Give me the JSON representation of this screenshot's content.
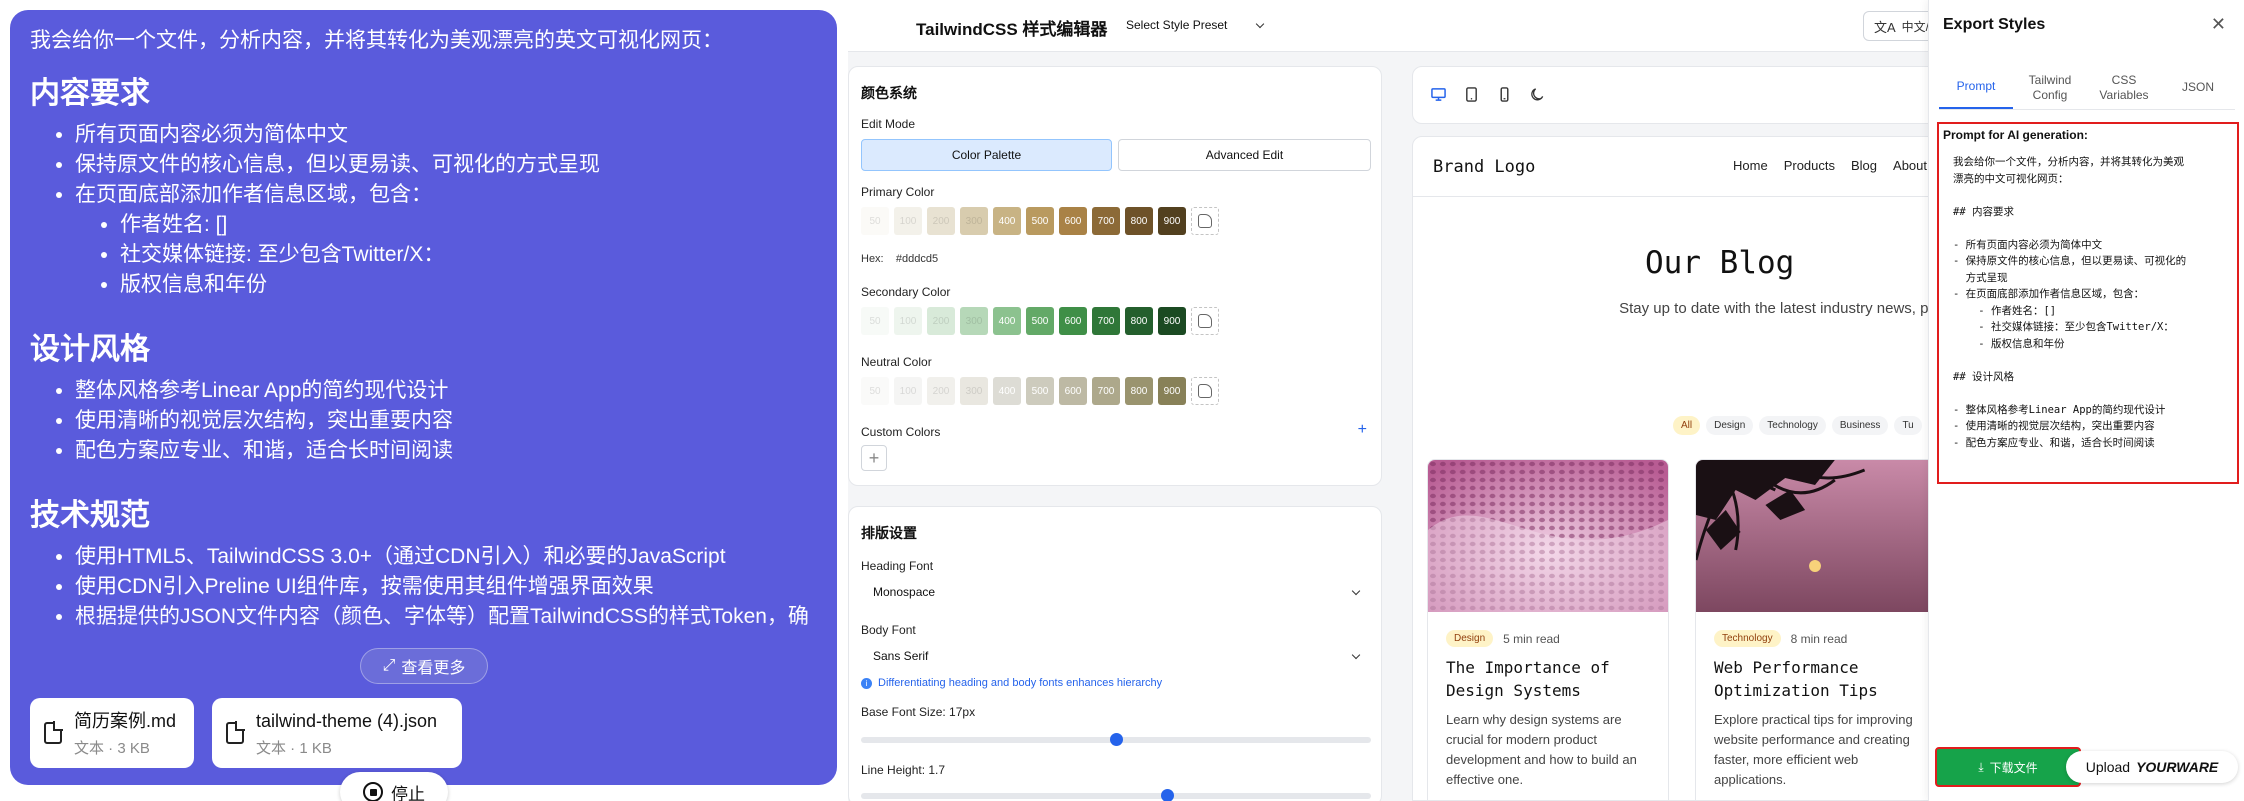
{
  "chat": {
    "intro": "我会给你一个文件，分析内容，并将其转化为美观漂亮的英文可视化网页：",
    "sections": [
      {
        "heading": "内容要求",
        "items": [
          "所有页面内容必须为简体中文",
          "保持原文件的核心信息，但以更易读、可视化的方式呈现",
          "在页面底部添加作者信息区域，包含："
        ],
        "subitems": [
          "作者姓名: []",
          "社交媒体链接: 至少包含Twitter/X：",
          "版权信息和年份"
        ]
      },
      {
        "heading": "设计风格",
        "items": [
          "整体风格参考Linear App的简约现代设计",
          "使用清晰的视觉层次结构，突出重要内容",
          "配色方案应专业、和谐，适合长时间阅读"
        ]
      },
      {
        "heading": "技术规范",
        "items": [
          "使用HTML5、TailwindCSS 3.0+（通过CDN引入）和必要的JavaScript",
          "使用CDN引入Preline UI组件库，按需使用其组件增强界面效果",
          "根据提供的JSON文件内容（颜色、字体等）配置TailwindCSS的样式Token，确"
        ]
      }
    ],
    "see_more": "查看更多",
    "files": [
      {
        "name": "简历案例.md",
        "meta": "文本 · 3 KB"
      },
      {
        "name": "tailwind-theme (4).json",
        "meta": "文本 · 1 KB"
      }
    ],
    "stop": "停止",
    "colors": {
      "bubble": "#5a5bdc"
    }
  },
  "editor": {
    "title": "TailwindCSS 样式编辑器",
    "preset": "Select Style Preset",
    "lang": "中文/E",
    "color_system": {
      "title": "颜色系统",
      "edit_mode_label": "Edit Mode",
      "modes": [
        "Color Palette",
        "Advanced Edit"
      ],
      "primary_label": "Primary Color",
      "hex_label": "Hex:",
      "hex_value": "#dddcd5",
      "secondary_label": "Secondary Color",
      "neutral_label": "Neutral Color",
      "custom_label": "Custom Colors",
      "shade_labels": [
        "50",
        "100",
        "200",
        "300",
        "400",
        "500",
        "600",
        "700",
        "800",
        "900"
      ],
      "primary": [
        "#fbfaf7",
        "#f3f1ea",
        "#e8e2d2",
        "#d8ccae",
        "#c8b384",
        "#b99a5f",
        "#a98246",
        "#8c6a37",
        "#6e5229",
        "#52401f"
      ],
      "secondary": [
        "#f7faf7",
        "#eef5ee",
        "#d8ead9",
        "#b6d8b8",
        "#8cc28f",
        "#63a967",
        "#3f8f47",
        "#2f7738",
        "#245f2d",
        "#1b4a22"
      ],
      "neutral": [
        "#fafaf9",
        "#f5f5f4",
        "#f1f0ec",
        "#e9e7e0",
        "#dddcd5",
        "#cdcbbd",
        "#bdb9a4",
        "#ada88b",
        "#9a946f",
        "#888158"
      ]
    },
    "typography": {
      "title": "排版设置",
      "heading_font_label": "Heading Font",
      "heading_font": "Monospace",
      "body_font_label": "Body Font",
      "body_font": "Sans Serif",
      "hint": "Differentiating heading and body fonts enhances hierarchy",
      "base_size_label": "Base Font Size: 17px",
      "base_size_fraction": 0.5,
      "line_height_label": "Line Height: 1.7",
      "line_height_fraction": 0.6
    }
  },
  "preview": {
    "logo": "Brand Logo",
    "nav": [
      "Home",
      "Products",
      "Blog",
      "About"
    ],
    "title": "Our Blog",
    "subtitle": "Stay up to date with the latest industry news, product inspiration.",
    "tags": [
      "All",
      "Design",
      "Technology",
      "Business",
      "Tu"
    ],
    "posts": [
      {
        "badge": "Design",
        "read": "5 min read",
        "title": "The Importance of Design Systems",
        "desc": "Learn why design systems are crucial for modern product development and how to build an effective one."
      },
      {
        "badge": "Technology",
        "read": "8 min read",
        "title": "Web Performance Optimization Tips",
        "desc": "Explore practical tips for improving website performance and creating faster, more efficient web applications."
      }
    ]
  },
  "export": {
    "title": "Export Styles",
    "tabs": [
      "Prompt",
      "Tailwind Config",
      "CSS Variables",
      "JSON"
    ],
    "prompt_label": "Prompt for AI generation:",
    "prompt_text": "我会给你一个文件，分析内容，并将其转化为美观\n漂亮的中文可视化网页：\n\n## 内容要求\n\n- 所有页面内容必须为简体中文\n- 保持原文件的核心信息，但以更易读、可视化的\n  方式呈现\n- 在页面底部添加作者信息区域，包含：\n    - 作者姓名：[]\n    - 社交媒体链接：至少包含Twitter/X：\n    - 版权信息和年份\n\n## 设计风格\n\n- 整体风格参考Linear App的简约现代设计\n- 使用清晰的视觉层次结构，突出重要内容\n- 配色方案应专业、和谐，适合长时间阅读",
    "download": "下载文件",
    "upload_prefix": "Upload",
    "upload_brand": "YOURWARE"
  }
}
